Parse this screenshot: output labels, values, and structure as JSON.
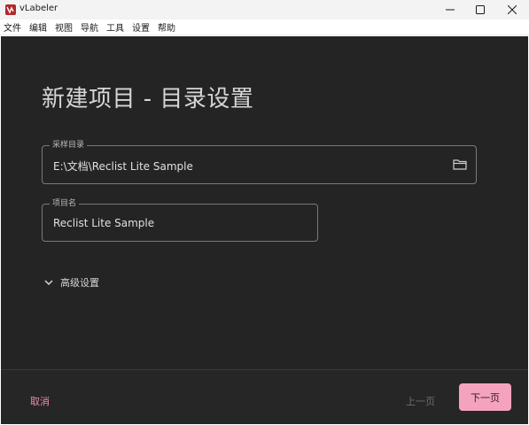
{
  "window": {
    "title": "vLabeler"
  },
  "menu": [
    "文件",
    "编辑",
    "视图",
    "导航",
    "工具",
    "设置",
    "帮助"
  ],
  "page": {
    "title": "新建项目 - 目录设置"
  },
  "fields": {
    "sample_dir": {
      "label": "采样目录",
      "value": "E:\\文档\\Reclist Lite Sample"
    },
    "project_name": {
      "label": "项目名",
      "value": "Reclist Lite Sample"
    }
  },
  "advanced": {
    "label": "高级设置"
  },
  "footer": {
    "cancel": "取消",
    "previous": "上一页",
    "next": "下一页"
  },
  "colors": {
    "background": "#242424",
    "accent": "#f4a3be",
    "cancel_text": "#f08aa6"
  },
  "icons": [
    "app-logo",
    "minimize-icon",
    "maximize-icon",
    "close-icon",
    "folder-icon",
    "chevron-down-icon"
  ]
}
